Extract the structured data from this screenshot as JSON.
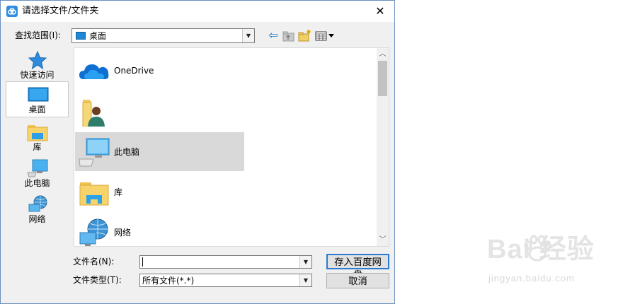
{
  "window": {
    "title": "请选择文件/文件夹",
    "close_label": "✕"
  },
  "toolbar": {
    "lookin_label": "查找范围(I):",
    "lookin_value": "桌面",
    "back_icon": "back-arrow-icon",
    "up_icon": "up-folder-icon",
    "new_folder_icon": "new-folder-icon",
    "view_icon": "view-menu-icon"
  },
  "places": [
    {
      "label": "快速访问",
      "icon": "star-icon",
      "selected": false
    },
    {
      "label": "桌面",
      "icon": "desktop-icon",
      "selected": true
    },
    {
      "label": "库",
      "icon": "library-folder-icon",
      "selected": false
    },
    {
      "label": "此电脑",
      "icon": "computer-icon",
      "selected": false
    },
    {
      "label": "网络",
      "icon": "network-icon",
      "selected": false
    }
  ],
  "files": [
    {
      "label": "OneDrive",
      "icon": "onedrive-cloud-icon",
      "selected": false
    },
    {
      "label": "",
      "icon": "user-folder-icon",
      "selected": false
    },
    {
      "label": "此电脑",
      "icon": "computer-icon",
      "selected": true
    },
    {
      "label": "库",
      "icon": "library-folder-icon",
      "selected": false
    },
    {
      "label": "网络",
      "icon": "network-icon",
      "selected": false
    }
  ],
  "filename": {
    "label": "文件名(N):",
    "value": ""
  },
  "filetype": {
    "label": "文件类型(T):",
    "value": "所有文件(*.*)"
  },
  "buttons": {
    "save": "存入百度网盘",
    "cancel": "取消"
  },
  "watermark": {
    "main": "Bai  经验",
    "sub": "jingyan.baidu.com"
  },
  "colors": {
    "accent": "#2b7bd0",
    "dialog_bg": "#f0f0f0",
    "selection": "#d9d9d9"
  }
}
